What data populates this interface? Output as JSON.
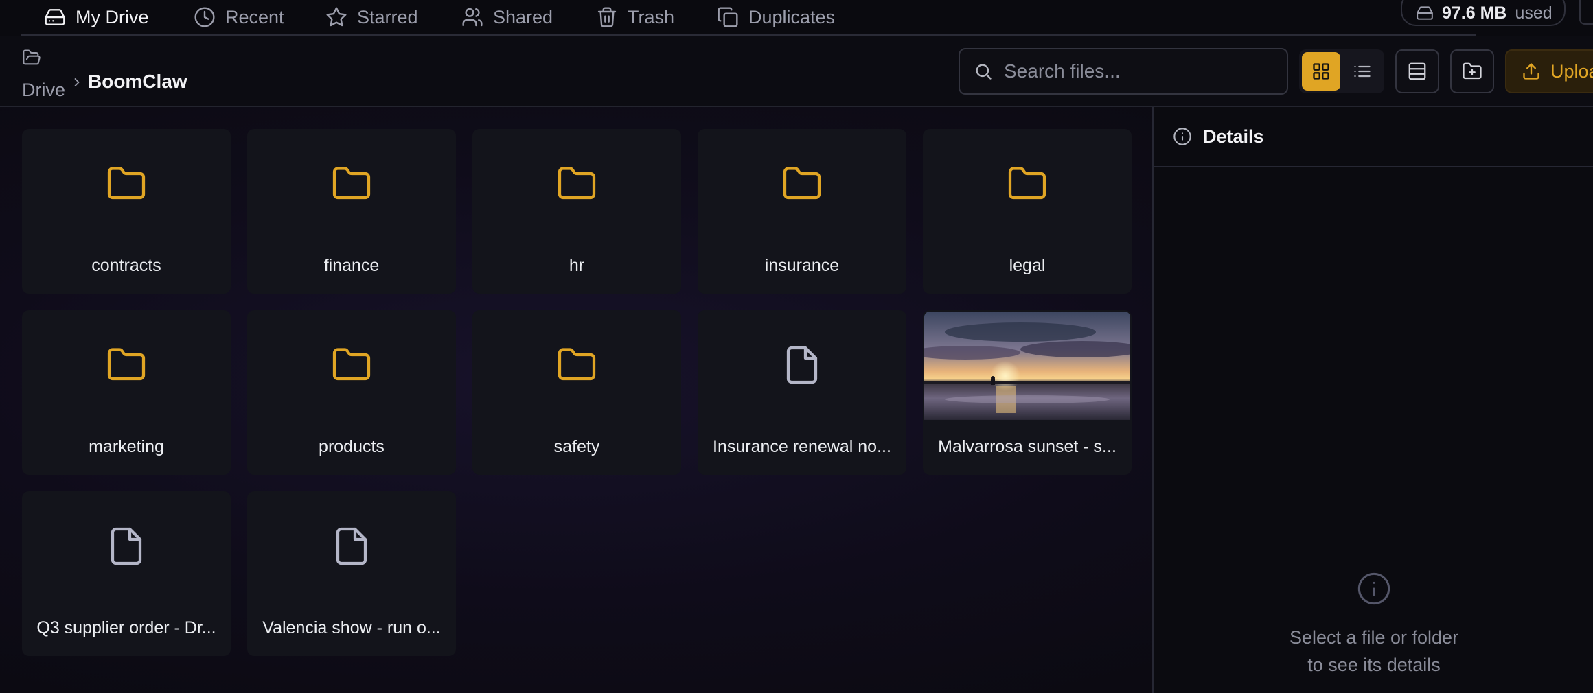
{
  "nav": {
    "tabs": [
      {
        "label": "My Drive",
        "icon": "hard-drive-icon",
        "active": true
      },
      {
        "label": "Recent",
        "icon": "clock-icon"
      },
      {
        "label": "Starred",
        "icon": "star-icon"
      },
      {
        "label": "Shared",
        "icon": "users-icon"
      },
      {
        "label": "Trash",
        "icon": "trash-icon"
      },
      {
        "label": "Duplicates",
        "icon": "copy-icon"
      }
    ],
    "storage": {
      "value": "97.6 MB",
      "suffix": "used"
    }
  },
  "toolbar": {
    "breadcrumb": {
      "root": "Drive",
      "current": "BoomClaw"
    },
    "search_placeholder": "Search files...",
    "upload_label": "Upload"
  },
  "items": [
    {
      "name": "contracts",
      "kind": "folder"
    },
    {
      "name": "finance",
      "kind": "folder"
    },
    {
      "name": "hr",
      "kind": "folder"
    },
    {
      "name": "insurance",
      "kind": "folder"
    },
    {
      "name": "legal",
      "kind": "folder"
    },
    {
      "name": "marketing",
      "kind": "folder"
    },
    {
      "name": "products",
      "kind": "folder"
    },
    {
      "name": "safety",
      "kind": "folder"
    },
    {
      "name": "Insurance renewal no...",
      "kind": "file"
    },
    {
      "name": "Malvarrosa sunset - s...",
      "kind": "image"
    },
    {
      "name": "Q3 supplier order - Dr...",
      "kind": "file"
    },
    {
      "name": "Valencia show - run o...",
      "kind": "file"
    }
  ],
  "details": {
    "title": "Details",
    "empty_line1": "Select a file or folder",
    "empty_line2": "to see its details"
  },
  "colors": {
    "accent": "#e0a524",
    "folder": "#e0a524",
    "file": "#b4b6c8"
  }
}
